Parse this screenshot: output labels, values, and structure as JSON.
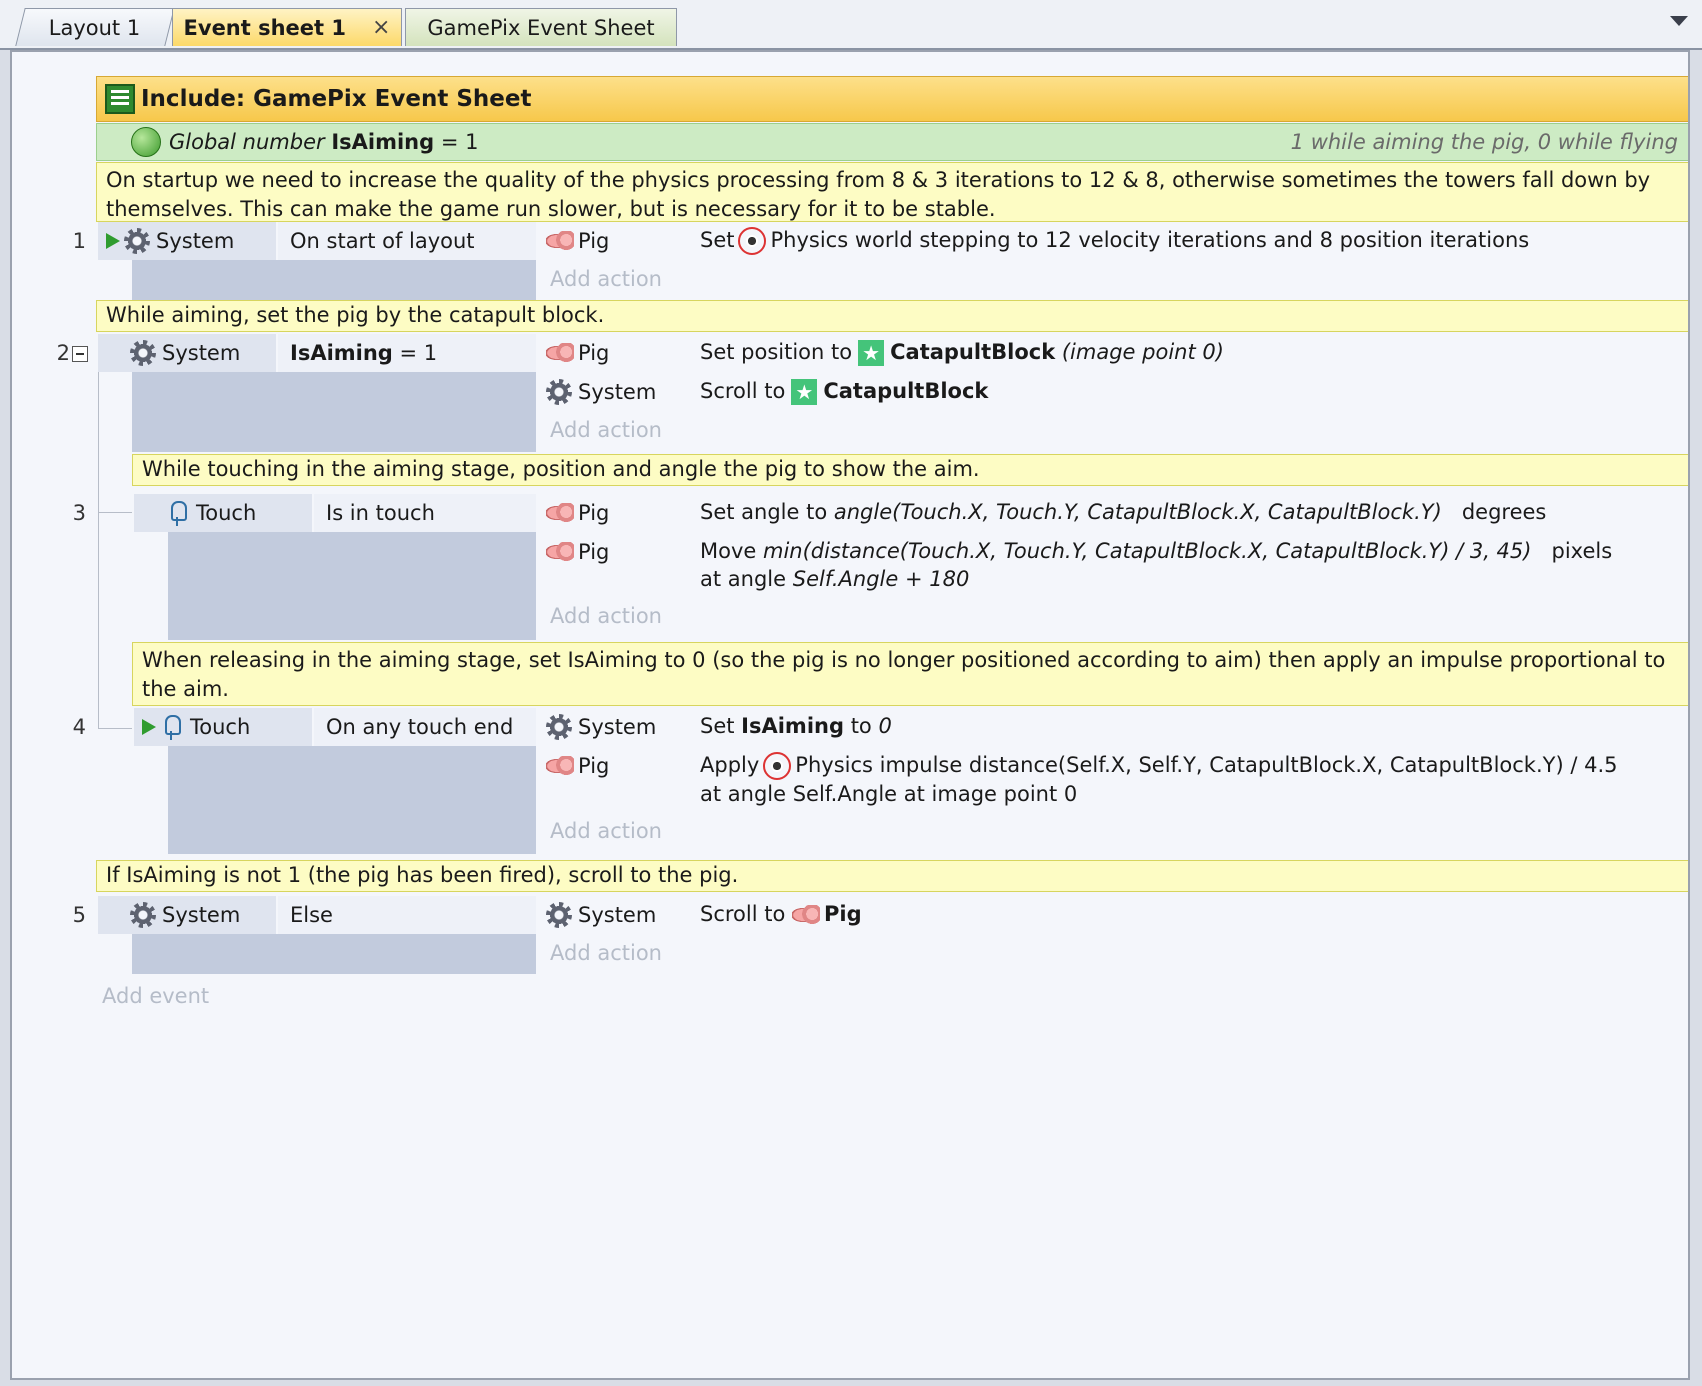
{
  "tabs": [
    {
      "label": "Layout 1"
    },
    {
      "label": "Event sheet 1",
      "close": "×"
    },
    {
      "label": "GamePix Event Sheet"
    }
  ],
  "include": {
    "label": "Include: GamePix Event Sheet"
  },
  "global": {
    "type": "Global number",
    "name": "IsAiming",
    "value": "= 1",
    "comment": "1 while aiming the pig, 0 while flying"
  },
  "comments": {
    "c1": "On startup we need to increase the quality of the physics processing from 8 & 3 iterations to 12 & 8, otherwise sometimes the towers fall down by themselves.  This can make the game run slower, but is necessary for it to be stable.",
    "c2": "While aiming, set the pig by the catapult block.",
    "c3": "While touching in the aiming stage, position and angle the pig to show the aim.",
    "c4": "When releasing in the aiming stage, set IsAiming to 0 (so the pig is no longer positioned according to aim) then apply an impulse proportional to the aim.",
    "c5": "If IsAiming is not 1 (the pig has been fired), scroll to the pig."
  },
  "events": {
    "e1": {
      "num": "1",
      "cond_obj": "System",
      "cond": "On start of layout",
      "a1_obj": "Pig",
      "a1_pre": "Set",
      "a1_txt": "Physics world stepping to 12 velocity iterations and 8 position iterations"
    },
    "e2": {
      "num": "2",
      "cond_obj": "System",
      "cond_name": "IsAiming",
      "cond_rest": "= 1",
      "a1_obj": "Pig",
      "a1_pre": "Set position to",
      "a1_name": "CatapultBlock",
      "a1_post": "(image point 0)",
      "a2_obj": "System",
      "a2_pre": "Scroll to",
      "a2_name": "CatapultBlock"
    },
    "e3": {
      "num": "3",
      "cond_obj": "Touch",
      "cond": "Is in touch",
      "a1_obj": "Pig",
      "a1_pre": "Set angle to",
      "a1_expr": "angle(Touch.X, Touch.Y, CatapultBlock.X, CatapultBlock.Y)",
      "a1_unit": "degrees",
      "a2_obj": "Pig",
      "a2_pre": "Move",
      "a2_expr": "min(distance(Touch.X, Touch.Y, CatapultBlock.X, CatapultBlock.Y) / 3, 45)",
      "a2_unit": "pixels",
      "a2_line2_pre": "at angle",
      "a2_line2_expr": "Self.Angle + 180"
    },
    "e4": {
      "num": "4",
      "cond_obj": "Touch",
      "cond": "On any touch end",
      "a1_obj": "System",
      "a1_pre": "Set",
      "a1_name": "IsAiming",
      "a1_mid": "to",
      "a1_val": "0",
      "a2_obj": "Pig",
      "a2_pre": "Apply",
      "a2_txt": "Physics impulse distance(Self.X, Self.Y, CatapultBlock.X, CatapultBlock.Y) / 4.5",
      "a2_line2": "at angle Self.Angle at image point 0"
    },
    "e5": {
      "num": "5",
      "cond_obj": "System",
      "cond": "Else",
      "a1_obj": "System",
      "a1_pre": "Scroll to",
      "a1_name": "Pig"
    }
  },
  "add_action": "Add action",
  "add_event": "Add event",
  "icons": {
    "include": "event-sheet-icon",
    "global": "globe-icon",
    "system": "gear-icon",
    "pig": "pig-icon",
    "touch": "touch-icon",
    "trigger": "green-arrow-icon",
    "physics": "physics-icon",
    "sprite": "star-sprite-icon",
    "collapse": "collapse-icon"
  }
}
